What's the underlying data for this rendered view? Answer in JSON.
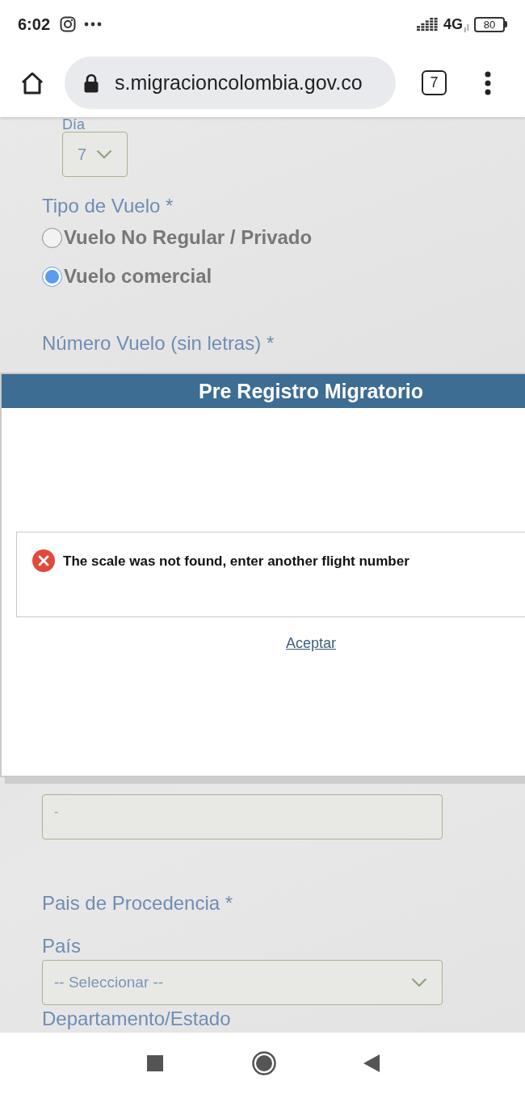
{
  "status_bar": {
    "time": "6:02",
    "network": "4G",
    "battery": "80"
  },
  "browser": {
    "url": "s.migracioncolombia.gov.co",
    "tab_count": "7"
  },
  "form": {
    "day": {
      "label": "Día",
      "value": "7"
    },
    "flight_type": {
      "label": "Tipo de Vuelo *",
      "options": [
        {
          "label": "Vuelo No Regular / Privado",
          "selected": false
        },
        {
          "label": "Vuelo comercial",
          "selected": true
        }
      ]
    },
    "flight_number": {
      "label": "Número Vuelo (sin letras) *"
    },
    "text_field": {
      "value": "-"
    },
    "origin": {
      "label": "Pais de Procedencia *",
      "country_label": "País",
      "country_select": "-- Seleccionar --"
    },
    "state": {
      "label": "Departamento/Estado"
    }
  },
  "dialog": {
    "title": "Pre Registro Migratorio",
    "message": "The scale was not found, enter another flight number",
    "button": "Aceptar"
  }
}
